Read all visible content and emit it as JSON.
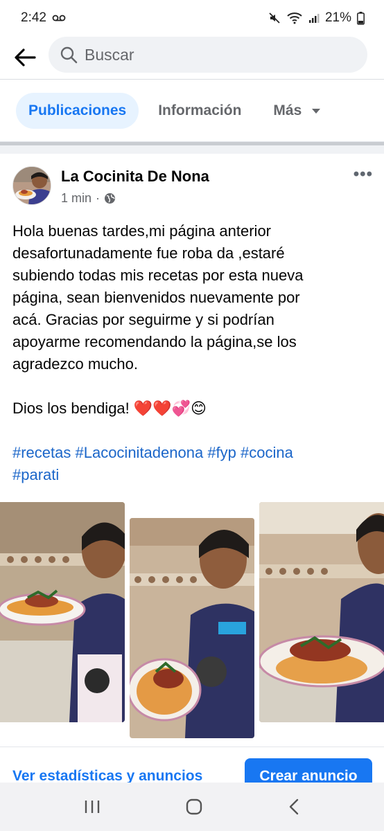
{
  "status": {
    "time": "2:42",
    "battery": "21%"
  },
  "search": {
    "placeholder": "Buscar"
  },
  "tabs": [
    {
      "label": "Publicaciones",
      "active": true
    },
    {
      "label": "Información",
      "active": false
    },
    {
      "label": "Más",
      "active": false
    }
  ],
  "post": {
    "page_name": "La Cocinita De Nona",
    "time": "1 min",
    "lines": [
      "Hola buenas tardes,mi página anterior",
      "desafortunadamente fue roba da ,estaré",
      "subiendo todas mis recetas por esta nueva",
      "página, sean bienvenidos nuevamente por",
      "acá. Gracias por seguirme y si podrían",
      "apoyarme recomendando la página,se los",
      "agradezco mucho."
    ],
    "blessing": "Dios los bendiga! ❤️❤️💞😊",
    "hashtags_line1": "#recetas #Lacocinitadenona #fyp #cocina",
    "hashtags_line2": "#parati"
  },
  "actions": {
    "stats_link": "Ver estadísticas y anuncios",
    "create_ad": "Crear anuncio"
  },
  "icons": [
    "voicemail-icon",
    "mute-icon",
    "wifi-icon",
    "signal-icon",
    "battery-icon",
    "back-arrow-icon",
    "search-icon",
    "dropdown-caret-icon",
    "globe-icon",
    "more-options-icon",
    "recents-icon",
    "home-icon",
    "back-icon"
  ],
  "colors": {
    "accent": "#1877f2",
    "tab_active_bg": "#e7f3ff",
    "hashtag": "#1b66c9",
    "muted": "#65676b"
  }
}
